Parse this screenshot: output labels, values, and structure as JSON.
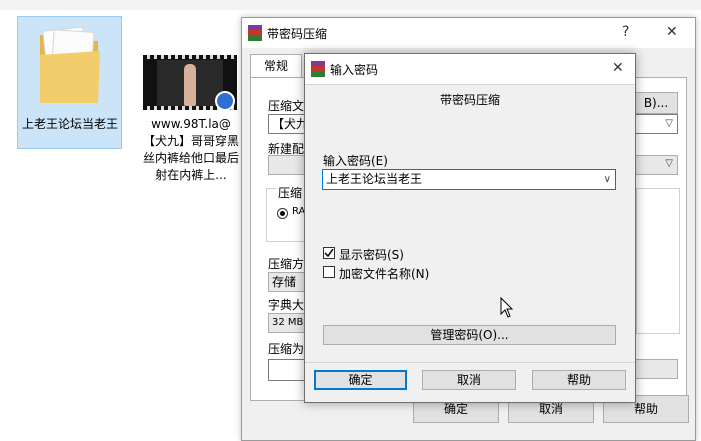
{
  "desktop": {
    "folder_label": "上老王论坛当老王",
    "video_label": "www.98T.la@ 【犬九】哥哥穿黑丝内裤给他口最后射在内裤上..."
  },
  "back_dialog": {
    "title": "带密码压缩",
    "help_glyph": "?",
    "close_glyph": "✕",
    "tab_general": "常规",
    "label_archive_name": "压缩文",
    "browse_label": "B)...",
    "archive_name_value": "【犬九",
    "label_profile": "新建配",
    "label_format": "压缩",
    "format_radio": "RA",
    "label_method": "压缩方",
    "method_value": "存储",
    "label_dict": "字典大",
    "dict_value": "32 MB",
    "label_split": "压缩为",
    "ok_label": "确定",
    "cancel_label": "取消",
    "help_label": "帮助"
  },
  "front_dialog": {
    "title": "输入密码",
    "close_glyph": "✕",
    "heading": "带密码压缩",
    "password_label": "输入密码(E)",
    "password_value": "上老王论坛当老王",
    "show_password_label": "显示密码(S)",
    "show_password_checked": true,
    "encrypt_names_label": "加密文件名称(N)",
    "encrypt_names_checked": false,
    "manage_button": "管理密码(O)...",
    "ok_label": "确定",
    "cancel_label": "取消",
    "help_label": "帮助"
  }
}
